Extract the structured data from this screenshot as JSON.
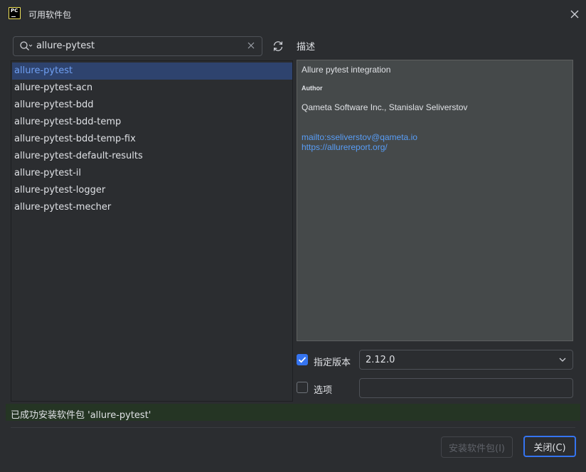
{
  "window": {
    "app_icon_text": "PC",
    "title": "可用软件包"
  },
  "search": {
    "value": "allure-pytest"
  },
  "packages": [
    {
      "name": "allure-pytest",
      "selected": true
    },
    {
      "name": "allure-pytest-acn",
      "selected": false
    },
    {
      "name": "allure-pytest-bdd",
      "selected": false
    },
    {
      "name": "allure-pytest-bdd-temp",
      "selected": false
    },
    {
      "name": "allure-pytest-bdd-temp-fix",
      "selected": false
    },
    {
      "name": "allure-pytest-default-results",
      "selected": false
    },
    {
      "name": "allure-pytest-il",
      "selected": false
    },
    {
      "name": "allure-pytest-logger",
      "selected": false
    },
    {
      "name": "allure-pytest-mecher",
      "selected": false
    }
  ],
  "description": {
    "label": "描述",
    "summary": "Allure pytest integration",
    "author_heading": "Author",
    "author": "Qameta Software Inc., Stanislav Seliverstov",
    "links": [
      "mailto:sseliverstov@qameta.io",
      "https://allurereport.org/"
    ]
  },
  "version": {
    "checkbox_label": "指定版本",
    "checked": true,
    "value": "2.12.0"
  },
  "options": {
    "checkbox_label": "选项",
    "checked": false,
    "value": ""
  },
  "status": {
    "text": "已成功安装软件包 'allure-pytest'"
  },
  "buttons": {
    "install": "安装软件包(I)",
    "close": "关闭(C)"
  },
  "colors": {
    "accent": "#3574f0",
    "selection": "#2e436e",
    "link": "#589df6",
    "status_success_bg": "#253524"
  },
  "icons": {
    "app": "pycharm-app-icon",
    "close": "close-icon",
    "search": "search-icon",
    "clear": "clear-icon",
    "refresh": "refresh-icon",
    "dropdown": "chevron-down-icon",
    "check": "checkmark-icon"
  }
}
